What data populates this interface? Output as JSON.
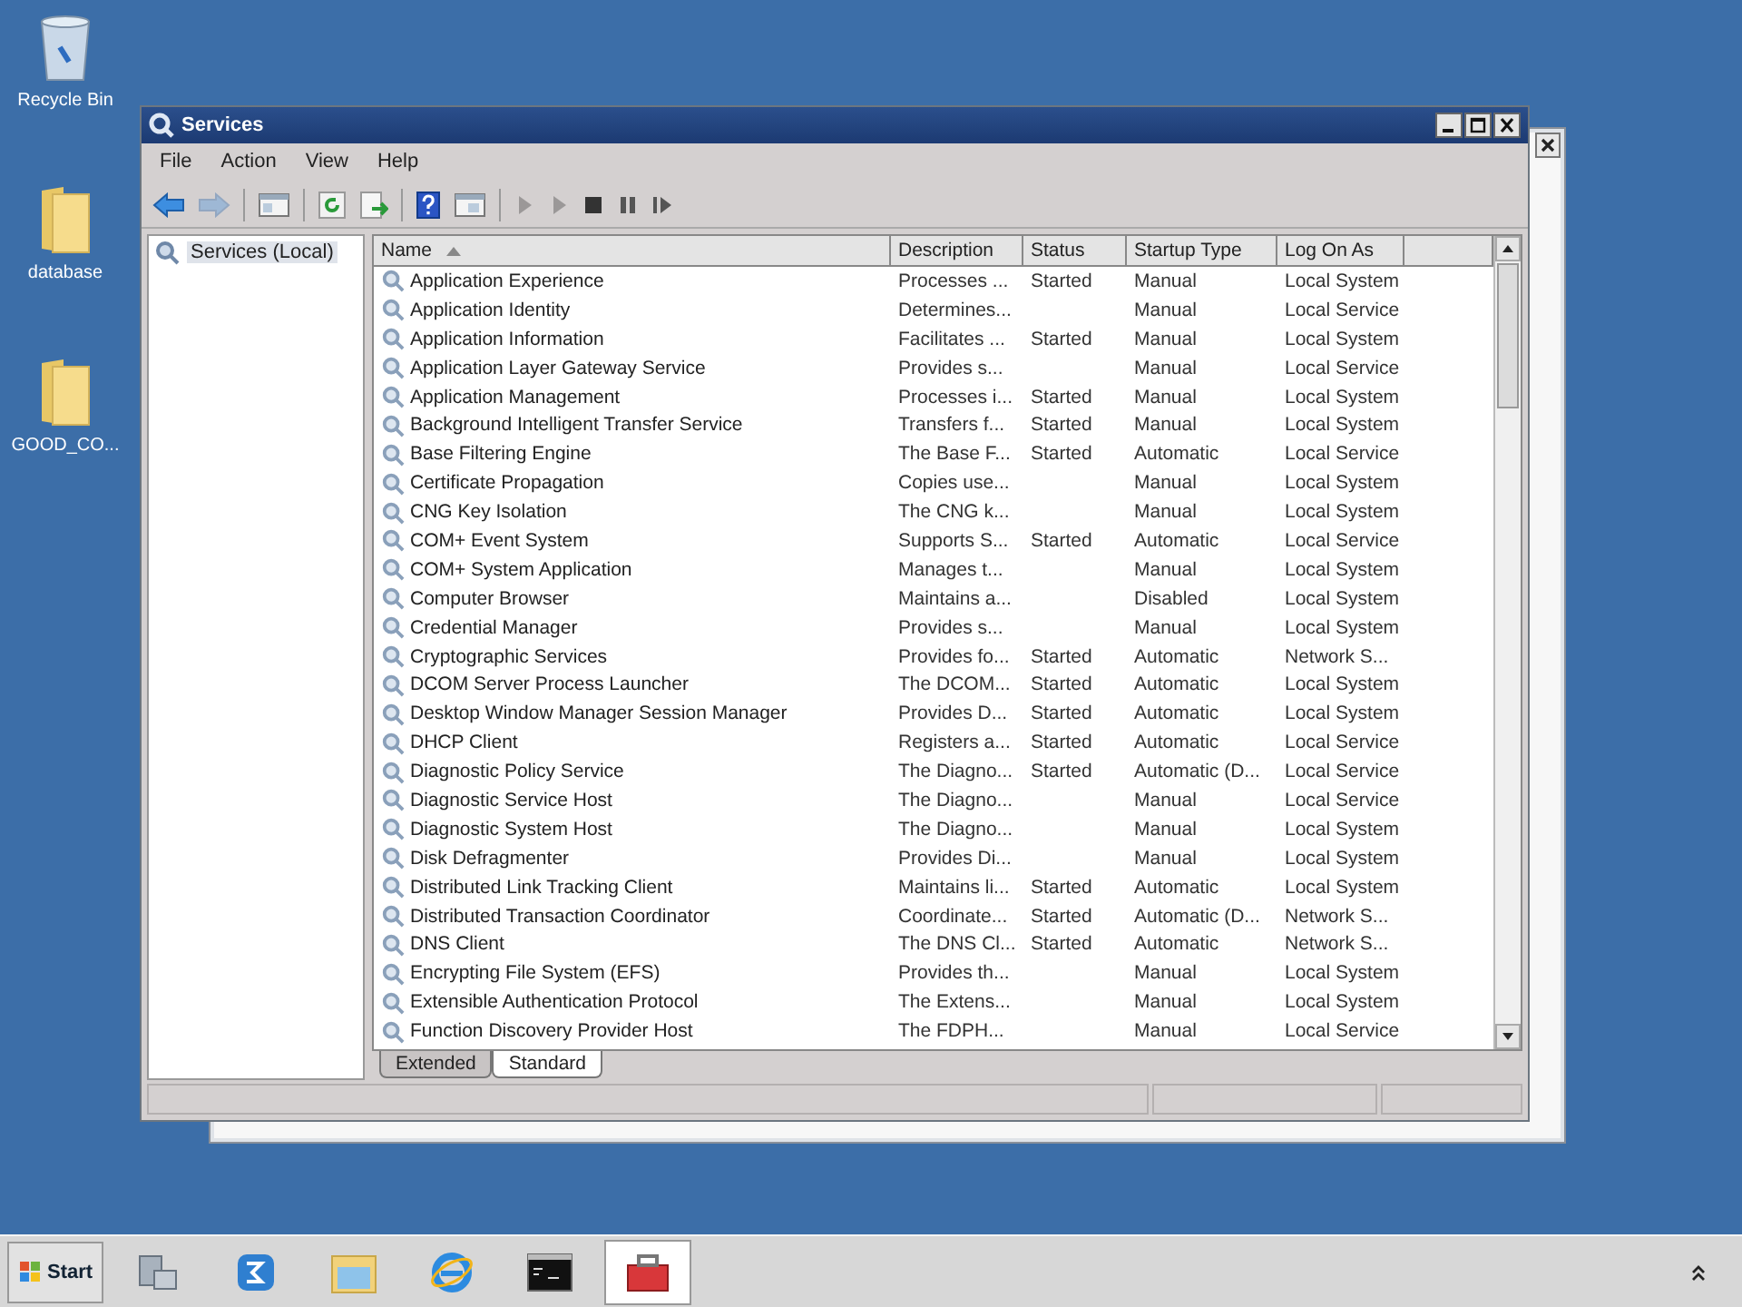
{
  "desktop_icons": [
    {
      "kind": "bin",
      "label": "Recycle Bin"
    },
    {
      "kind": "folder",
      "label": "database"
    },
    {
      "kind": "folder",
      "label": "GOOD_CO..."
    }
  ],
  "window": {
    "title": "Services"
  },
  "menu": [
    "File",
    "Action",
    "View",
    "Help"
  ],
  "toolbar": [
    [
      {
        "kind": "back",
        "disabled": false
      },
      {
        "kind": "forward",
        "disabled": true
      }
    ],
    [
      {
        "kind": "console-tree",
        "disabled": false
      }
    ],
    [
      {
        "kind": "refresh",
        "disabled": false
      },
      {
        "kind": "export",
        "disabled": false
      }
    ],
    [
      {
        "kind": "help",
        "disabled": false
      },
      {
        "kind": "properties",
        "disabled": false
      }
    ],
    [
      {
        "kind": "start",
        "disabled": true
      },
      {
        "kind": "start",
        "disabled": true
      },
      {
        "kind": "stop",
        "disabled": false
      },
      {
        "kind": "pause",
        "disabled": false
      },
      {
        "kind": "resume",
        "disabled": false
      }
    ]
  ],
  "tree": [
    {
      "label": "Services (Local)",
      "selected": true
    }
  ],
  "table": {
    "columns": [
      "Name",
      "Description",
      "Status",
      "Startup Type",
      "Log On As"
    ],
    "rows": [
      {
        "name": "Application Experience",
        "description": "Processes ...",
        "status": "Started",
        "startup_type": "Manual",
        "log_on_as": "Local System"
      },
      {
        "name": "Application Identity",
        "description": "Determines...",
        "startup_type": "Manual",
        "log_on_as": "Local Service"
      },
      {
        "name": "Application Information",
        "description": "Facilitates ...",
        "status": "Started",
        "startup_type": "Manual",
        "log_on_as": "Local System"
      },
      {
        "name": "Application Layer Gateway Service",
        "description": "Provides s...",
        "startup_type": "Manual",
        "log_on_as": "Local Service"
      },
      {
        "name": "Application Management",
        "description": "Processes i...",
        "status": "Started",
        "startup_type": "Manual",
        "log_on_as": "Local System"
      },
      {
        "name": "Background Intelligent Transfer Service",
        "description": "Transfers f...",
        "status": "Started",
        "startup_type": "Manual",
        "log_on_as": "Local System"
      },
      {
        "name": "Base Filtering Engine",
        "description": "The Base F...",
        "status": "Started",
        "startup_type": "Automatic",
        "log_on_as": "Local Service"
      },
      {
        "name": "Certificate Propagation",
        "description": "Copies use...",
        "startup_type": "Manual",
        "log_on_as": "Local System"
      },
      {
        "name": "CNG Key Isolation",
        "description": "The CNG k...",
        "startup_type": "Manual",
        "log_on_as": "Local System"
      },
      {
        "name": "COM+ Event System",
        "description": "Supports S...",
        "status": "Started",
        "startup_type": "Automatic",
        "log_on_as": "Local Service"
      },
      {
        "name": "COM+ System Application",
        "description": "Manages t...",
        "startup_type": "Manual",
        "log_on_as": "Local System"
      },
      {
        "name": "Computer Browser",
        "description": "Maintains a...",
        "startup_type": "Disabled",
        "log_on_as": "Local System"
      },
      {
        "name": "Credential Manager",
        "description": "Provides s...",
        "startup_type": "Manual",
        "log_on_as": "Local System"
      },
      {
        "name": "Cryptographic Services",
        "description": "Provides fo...",
        "status": "Started",
        "startup_type": "Automatic",
        "log_on_as": "Network S..."
      },
      {
        "name": "DCOM Server Process Launcher",
        "description": "The DCOM...",
        "status": "Started",
        "startup_type": "Automatic",
        "log_on_as": "Local System"
      },
      {
        "name": "Desktop Window Manager Session Manager",
        "description": "Provides D...",
        "status": "Started",
        "startup_type": "Automatic",
        "log_on_as": "Local System"
      },
      {
        "name": "DHCP Client",
        "description": "Registers a...",
        "status": "Started",
        "startup_type": "Automatic",
        "log_on_as": "Local Service"
      },
      {
        "name": "Diagnostic Policy Service",
        "description": "The Diagno...",
        "status": "Started",
        "startup_type": "Automatic (D...",
        "log_on_as": "Local Service"
      },
      {
        "name": "Diagnostic Service Host",
        "description": "The Diagno...",
        "startup_type": "Manual",
        "log_on_as": "Local Service"
      },
      {
        "name": "Diagnostic System Host",
        "description": "The Diagno...",
        "startup_type": "Manual",
        "log_on_as": "Local System"
      },
      {
        "name": "Disk Defragmenter",
        "description": "Provides Di...",
        "startup_type": "Manual",
        "log_on_as": "Local System"
      },
      {
        "name": "Distributed Link Tracking Client",
        "description": "Maintains li...",
        "status": "Started",
        "startup_type": "Automatic",
        "log_on_as": "Local System"
      },
      {
        "name": "Distributed Transaction Coordinator",
        "description": "Coordinate...",
        "status": "Started",
        "startup_type": "Automatic (D...",
        "log_on_as": "Network S..."
      },
      {
        "name": "DNS Client",
        "description": "The DNS Cl...",
        "status": "Started",
        "startup_type": "Automatic",
        "log_on_as": "Network S..."
      },
      {
        "name": "Encrypting File System (EFS)",
        "description": "Provides th...",
        "startup_type": "Manual",
        "log_on_as": "Local System"
      },
      {
        "name": "Extensible Authentication Protocol",
        "description": "The Extens...",
        "startup_type": "Manual",
        "log_on_as": "Local System"
      },
      {
        "name": "Function Discovery Provider Host",
        "description": "The FDPH...",
        "startup_type": "Manual",
        "log_on_as": "Local Service"
      }
    ]
  },
  "tabs": [
    {
      "label": "Extended",
      "selected": false
    },
    {
      "label": "Standard",
      "selected": true
    }
  ],
  "taskbar": {
    "start": "Start",
    "apps": [
      {
        "kind": "server",
        "selected": false
      },
      {
        "kind": "powershell",
        "selected": false
      },
      {
        "kind": "explorer",
        "selected": false
      },
      {
        "kind": "browser",
        "selected": false
      },
      {
        "kind": "terminal",
        "selected": false
      },
      {
        "kind": "toolbox",
        "selected": true
      }
    ]
  }
}
